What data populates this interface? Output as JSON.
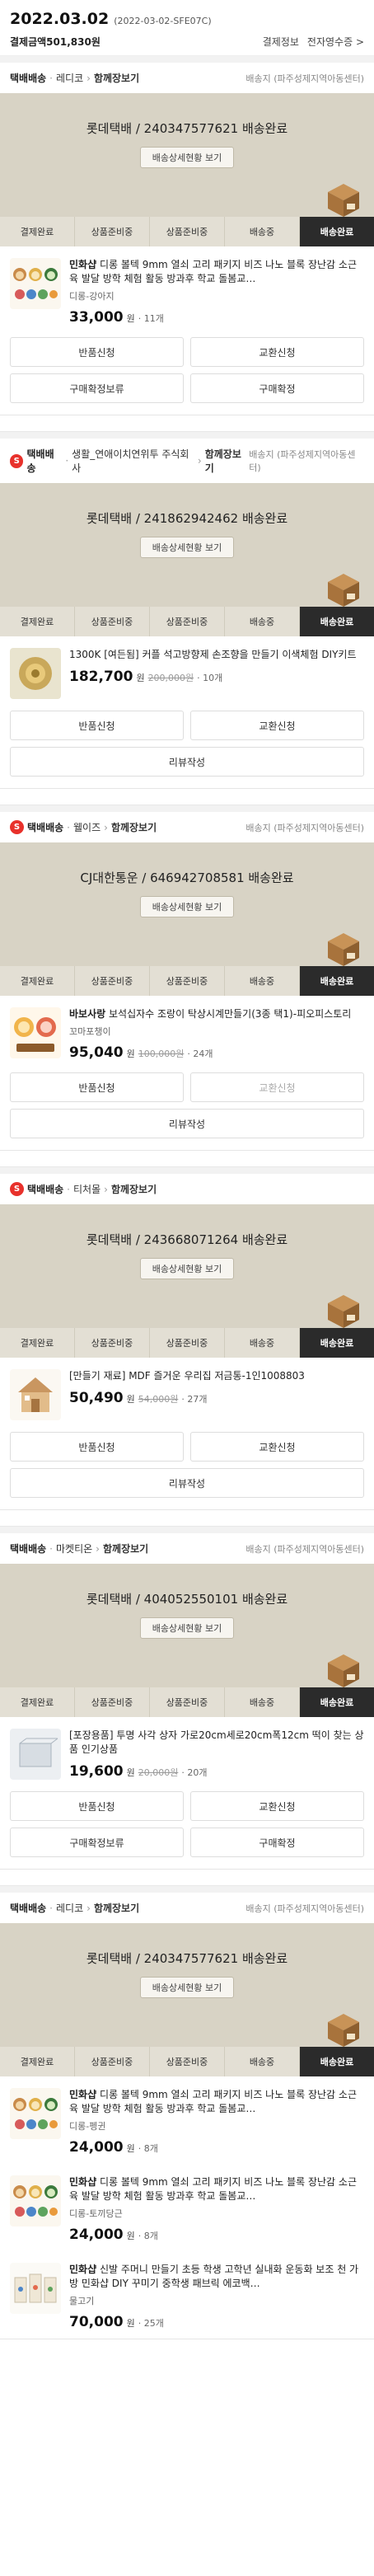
{
  "order": {
    "date": "2022.03.02",
    "code": "(2022-03-02-SFE07C)",
    "amount_label": "결제금액",
    "amount": "501,830원",
    "link_payment": "결제정보",
    "link_receipt": "전자영수증",
    "receipt_arrow": ">"
  },
  "steps": [
    "결제완료",
    "상품준비중",
    "상품준비중",
    "배송중",
    "배송완료"
  ],
  "shipments": [
    {
      "s_badge": "",
      "method": "택배배송",
      "seller": "레디코",
      "together": "함께장보기",
      "region": "배송지 (파주성제지역아동센터)",
      "tracking": "롯데택배 / 240347577621 배송완료",
      "detail_btn": "배송상세현황 보기",
      "items": [
        {
          "brand": "민화샵",
          "title": " 디롱 볼텍 9mm 열쇠 고리 패키지 비즈 나노 블록 장난감 소근육 발달 방학 체험 활동 방과후 학교 돌봄교…",
          "option": "디롱-강아지",
          "price": "33,000",
          "won": "원",
          "orig": "",
          "qty": "· 11개",
          "thumb": "dolls"
        }
      ],
      "actions": [
        {
          "label": "반품신청",
          "full": false,
          "disabled": false
        },
        {
          "label": "교환신청",
          "full": false,
          "disabled": false
        },
        {
          "label": "구매확정보류",
          "full": false,
          "disabled": false
        },
        {
          "label": "구매확정",
          "full": false,
          "disabled": false
        }
      ]
    },
    {
      "s_badge": "S",
      "method": "택배배송",
      "seller": "생활_연애이치연위투 주식회사",
      "together": "함께장보기",
      "region": "배송지 (파주성제지역아동센터)",
      "tracking": "롯데택배 / 241862942462 배송완료",
      "detail_btn": "배송상세현황 보기",
      "items": [
        {
          "brand": "",
          "title": "1300K [여든됨] 커플 석고방향제 손조향을 만들기 이색체험 DIY키트",
          "option": "",
          "price": "182,700",
          "won": "원",
          "orig": "200,000원",
          "qty": "· 10개",
          "thumb": "flower"
        }
      ],
      "actions": [
        {
          "label": "반품신청",
          "full": false,
          "disabled": false
        },
        {
          "label": "교환신청",
          "full": false,
          "disabled": false
        },
        {
          "label": "리뷰작성",
          "full": true,
          "disabled": false
        }
      ]
    },
    {
      "s_badge": "S",
      "method": "택배배송",
      "seller": "웰이즈",
      "together": "함께장보기",
      "region": "배송지 (파주성제지역아동센터)",
      "tracking": "CJ대한통운 / 646942708581 배송완료",
      "detail_btn": "배송상세현황 보기",
      "items": [
        {
          "brand": "바보사랑",
          "title": " 보석십자수 조랑이 탁상시계만들기(3종 택1)-피오피스토리",
          "option": "꼬마포챙이",
          "price": "95,040",
          "won": "원",
          "orig": "100,000원",
          "qty": "· 24개",
          "thumb": "clocks"
        }
      ],
      "actions": [
        {
          "label": "반품신청",
          "full": false,
          "disabled": false
        },
        {
          "label": "교환신청",
          "full": false,
          "disabled": true
        },
        {
          "label": "리뷰작성",
          "full": true,
          "disabled": false
        }
      ]
    },
    {
      "s_badge": "S",
      "method": "택배배송",
      "seller": "티처몰",
      "together": "함께장보기",
      "region": "",
      "tracking": "롯데택배 / 243668071264 배송완료",
      "detail_btn": "배송상세현황 보기",
      "items": [
        {
          "brand": "",
          "title": "[만들기 재료] MDF 즐거운 우리집 저금통-1인1008803",
          "option": "",
          "price": "50,490",
          "won": "원",
          "orig": "54,000원",
          "qty": "· 27개",
          "thumb": "house"
        }
      ],
      "actions": [
        {
          "label": "반품신청",
          "full": false,
          "disabled": false
        },
        {
          "label": "교환신청",
          "full": false,
          "disabled": false
        },
        {
          "label": "리뷰작성",
          "full": true,
          "disabled": false
        }
      ]
    },
    {
      "s_badge": "",
      "method": "택배배송",
      "seller": "마켓티온",
      "together": "함께장보기",
      "region": "배송지 (파주성제지역아동센터)",
      "tracking": "롯데택배 / 404052550101 배송완료",
      "detail_btn": "배송상세현황 보기",
      "items": [
        {
          "brand": "",
          "title": "[포장용품] 투명 사각 상자 가로20cm세로20cm폭12cm 떡이 찾는 상품 인기상품",
          "option": "",
          "price": "19,600",
          "won": "원",
          "orig": "20,000원",
          "qty": "· 20개",
          "thumb": "clearbox"
        }
      ],
      "actions": [
        {
          "label": "반품신청",
          "full": false,
          "disabled": false
        },
        {
          "label": "교환신청",
          "full": false,
          "disabled": false
        },
        {
          "label": "구매확정보류",
          "full": false,
          "disabled": false
        },
        {
          "label": "구매확정",
          "full": false,
          "disabled": false
        }
      ]
    },
    {
      "s_badge": "",
      "method": "택배배송",
      "seller": "레디코",
      "together": "함께장보기",
      "region": "배송지 (파주성제지역아동센터)",
      "tracking": "롯데택배 / 240347577621 배송완료",
      "detail_btn": "배송상세현황 보기",
      "items": [
        {
          "brand": "민화샵",
          "title": " 디롱 볼텍 9mm 열쇠 고리 패키지 비즈 나노 블록 장난감 소근육 발달 방학 체험 활동 방과후 학교 돌봄교…",
          "option": "디롱-펭귄",
          "price": "24,000",
          "won": "원",
          "orig": "",
          "qty": "· 8개",
          "thumb": "dolls"
        },
        {
          "brand": "민화샵",
          "title": " 디롱 볼텍 9mm 열쇠 고리 패키지 비즈 나노 블록 장난감 소근육 발달 방학 체험 활동 방과후 학교 돌봄교…",
          "option": "디롱-토끼당근",
          "price": "24,000",
          "won": "원",
          "orig": "",
          "qty": "· 8개",
          "thumb": "dolls"
        },
        {
          "brand": "민화샵",
          "title": " 신발 주머니 만들기 초등 학생 고학년 실내화 운동화 보조 천 가방 민화샵 DIY 꾸미기 중학생 패브릭 에코백…",
          "option": "물고기",
          "price": "70,000",
          "won": "원",
          "orig": "",
          "qty": "· 25개",
          "thumb": "bags"
        }
      ],
      "actions": []
    }
  ]
}
